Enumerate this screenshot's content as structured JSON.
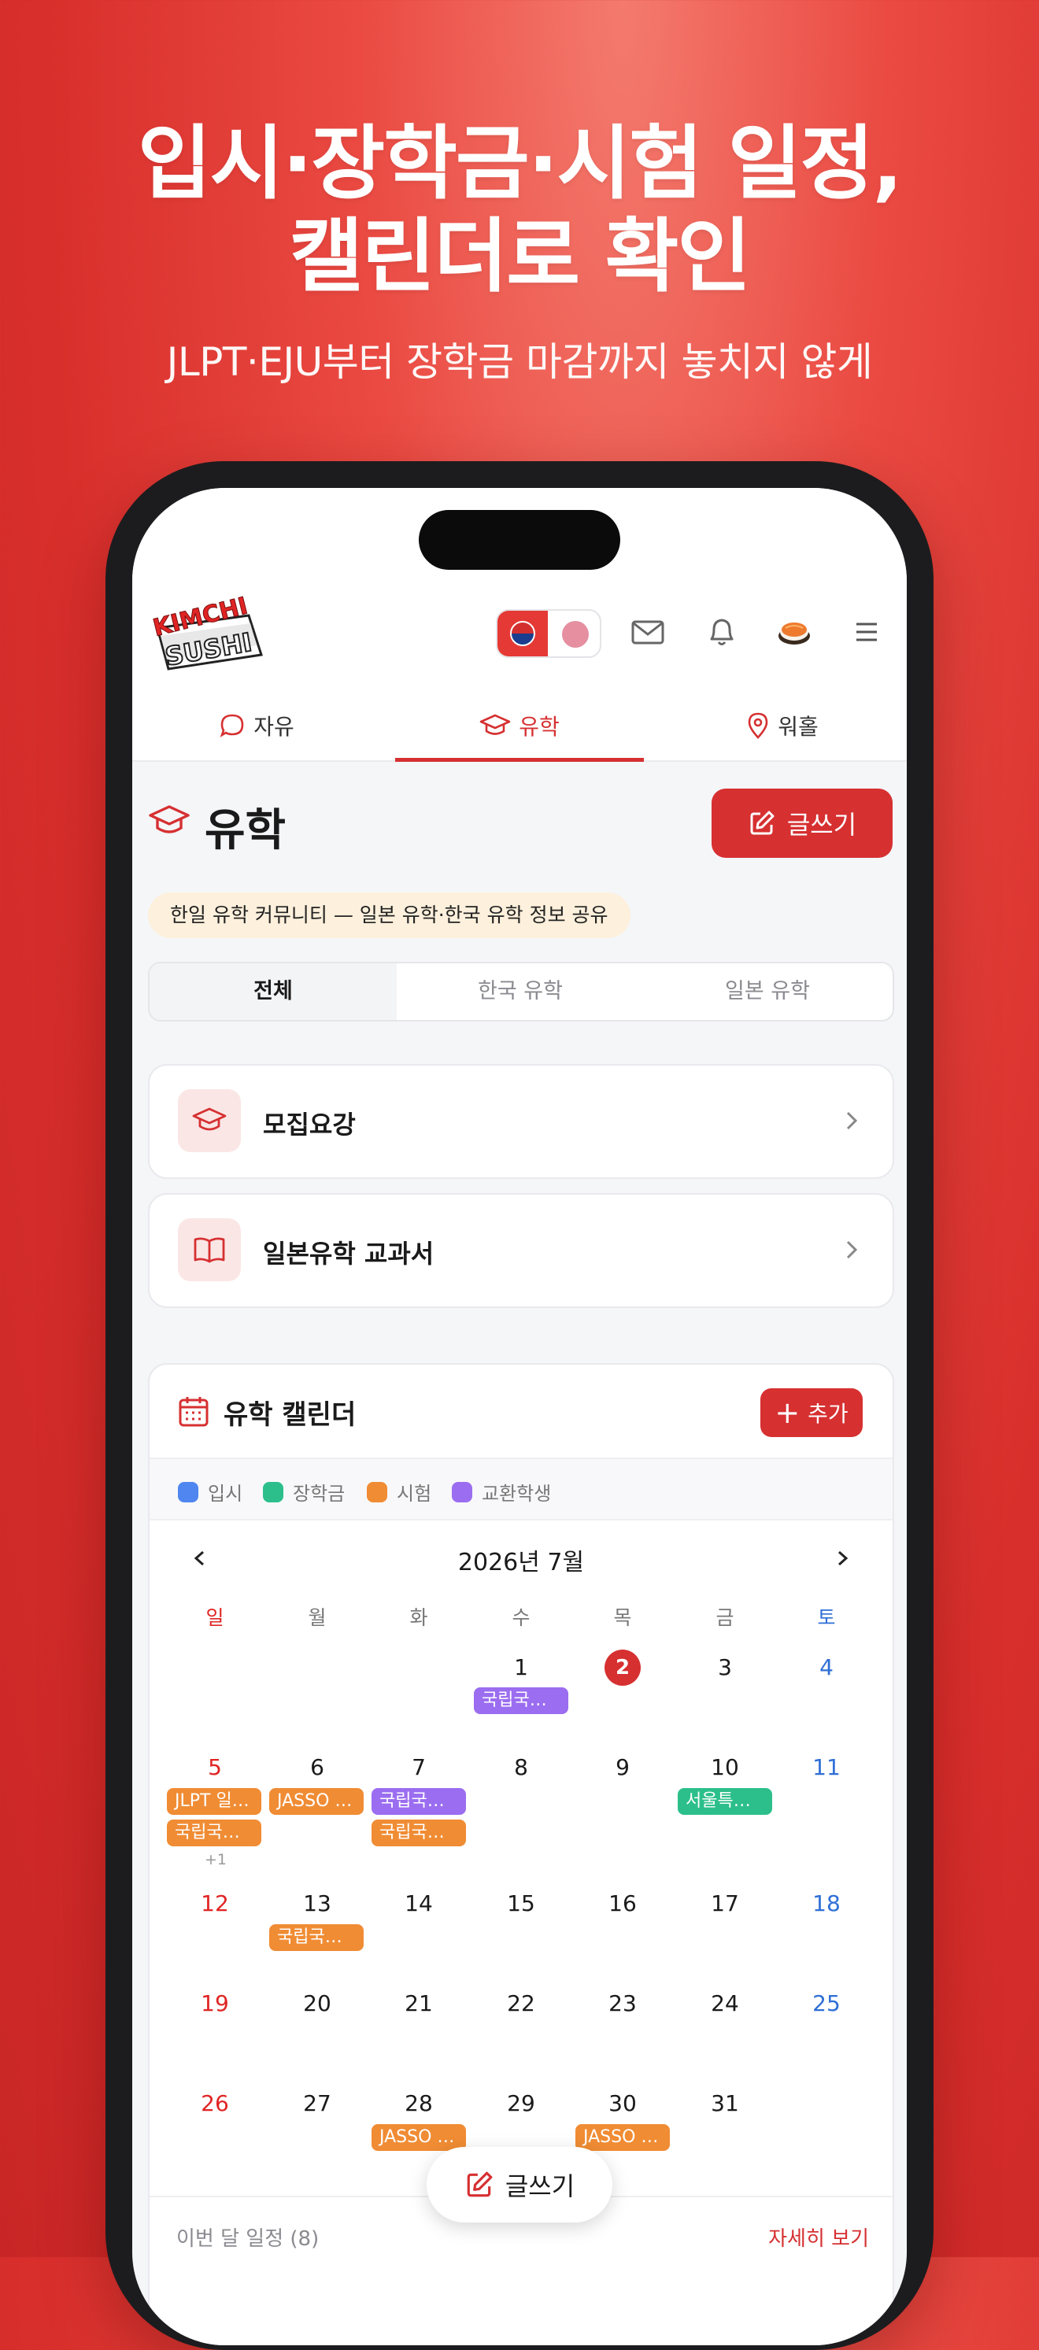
{
  "promo": {
    "headline_line1": "입시·장학금·시험 일정,",
    "headline_line2": "캘린더로 확인",
    "subline": "JLPT·EJU부터 장학금 마감까지 놓치지 않게"
  },
  "appbar": {
    "logo_text": "KIMCHI SUSHI",
    "icons": [
      "flag-kr-icon",
      "flag-jp-icon",
      "mail-icon",
      "bell-icon",
      "sushi-avatar-icon",
      "menu-icon"
    ]
  },
  "nav": {
    "tabs": [
      {
        "label": "자유",
        "icon": "chat-bubble-icon"
      },
      {
        "label": "유학",
        "icon": "graduation-cap-icon",
        "active": true
      },
      {
        "label": "워홀",
        "icon": "map-pin-icon"
      }
    ]
  },
  "page": {
    "title": "유학",
    "write_label": "글쓰기",
    "description": "한일 유학 커뮤니티 — 일본 유학·한국 유학 정보 공유",
    "segments": [
      "전체",
      "한국 유학",
      "일본 유학"
    ],
    "selected_segment": "전체"
  },
  "cards": [
    {
      "label": "모집요강",
      "icon": "graduation-cap-icon"
    },
    {
      "label": "일본유학 교과서",
      "icon": "book-icon"
    }
  ],
  "calendar": {
    "title": "유학 캘린더",
    "add_label": "추가",
    "legend": [
      {
        "label": "입시",
        "color": "#4f86f0"
      },
      {
        "label": "장학금",
        "color": "#2cbf8b"
      },
      {
        "label": "시험",
        "color": "#f08c34"
      },
      {
        "label": "교환학생",
        "color": "#9b6df0"
      }
    ],
    "month_label": "2026년 7월",
    "weekdays": [
      "일",
      "월",
      "화",
      "수",
      "목",
      "금",
      "토"
    ],
    "today": "2",
    "weeks": [
      [
        "",
        "",
        "",
        "1",
        "2",
        "3",
        "4"
      ],
      [
        "5",
        "6",
        "7",
        "8",
        "9",
        "10",
        "11"
      ],
      [
        "12",
        "13",
        "14",
        "15",
        "16",
        "17",
        "18"
      ],
      [
        "19",
        "20",
        "21",
        "22",
        "23",
        "24",
        "25"
      ],
      [
        "26",
        "27",
        "28",
        "29",
        "30",
        "31",
        ""
      ]
    ],
    "events": {
      "w0_wed": "국립국…",
      "w1_sun_1": "JLPT 일…",
      "w1_sun_2": "국립국…",
      "w1_sun_more": "+1",
      "w1_mon": "JASSO …",
      "w1_tue_1": "국립국…",
      "w1_tue_2": "국립국…",
      "w1_fri": "서울특…",
      "w2_mon": "국립국…",
      "w4_tue": "JASSO …",
      "w4_thu": "JASSO …"
    },
    "footer_left": "이번 달 일정 (8)",
    "footer_right": "자세히 보기"
  },
  "floating": {
    "label": "글쓰기"
  }
}
